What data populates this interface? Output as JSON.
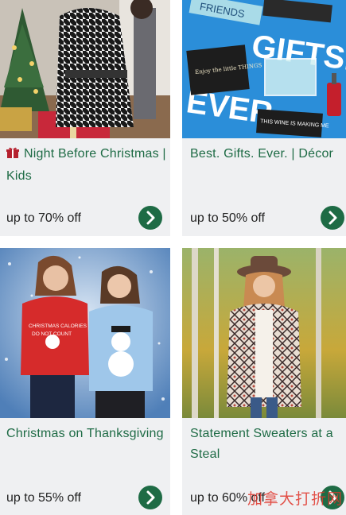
{
  "cards": [
    {
      "title": "Night Before Christmas | Kids",
      "offer": "up to 70% off",
      "icon": "gift-icon",
      "image": "kids-houndstooth-coat-photo"
    },
    {
      "title": "Best. Gifts. Ever. | Décor",
      "offer": "up to 50% off",
      "image": "gifts-ever-decor-photo",
      "image_text": {
        "gifts": "GIFTS.",
        "ever": "EVER.",
        "friends": "FRIENDS",
        "wine": "THIS WINE IS MAKING ME",
        "enjoy": "Enjoy the little THINGS"
      }
    },
    {
      "title": "Christmas on Thanksgiving",
      "offer": "up to 55% off",
      "image": "christmas-sweaters-photo",
      "image_text": {
        "sweater": "CHRISTMAS CALORIES DO NOT COUNT"
      }
    },
    {
      "title": "Statement Sweaters at a Steal",
      "offer": "up to 60% off",
      "image": "statement-sweater-cardigan-photo"
    }
  ],
  "watermark": "加拿大打折网",
  "colors": {
    "accent": "#1e6b45",
    "card_bg": "#eff0f2",
    "text": "#222222",
    "watermark": "#e0352b"
  }
}
